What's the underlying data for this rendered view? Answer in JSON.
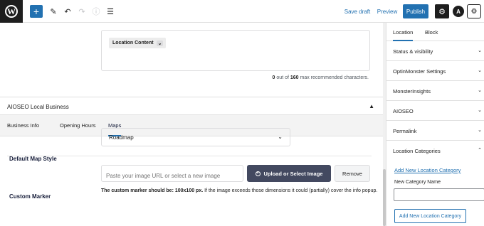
{
  "toolbar": {
    "logo": "W",
    "add_icon": "+",
    "edit_icon": "✎",
    "undo_icon": "↶",
    "redo_icon": "↷",
    "info_icon": "ⓘ",
    "list_icon": "☰",
    "save_draft": "Save draft",
    "preview": "Preview",
    "publish": "Publish",
    "settings_icon": "⚙",
    "aioseo_icon": "A",
    "monsterinsights_icon": "⚙"
  },
  "editor": {
    "content_pill": "Location Content",
    "pill_chevron": "⌄",
    "char_count": "0",
    "char_max": "160",
    "char_suffix": "out of",
    "char_tail": "max recommended characters."
  },
  "metabox": {
    "title": "AIOSEO Local Business",
    "collapse_icon": "▲",
    "tabs": [
      "Business Info",
      "Opening Hours",
      "Maps"
    ],
    "active_tab": "Maps",
    "map_style_label": "Default Map Style",
    "map_style_value": "Roadmap",
    "custom_marker_label": "Custom Marker",
    "image_placeholder": "Paste your image URL or select a new image",
    "upload_button": "Upload or Select Image",
    "remove_button": "Remove",
    "note_bold": "The custom marker should be: 100x100 px.",
    "note_text": " If the image exceeds those dimensions it could (partially) cover the info popup."
  },
  "sidebar": {
    "tabs": [
      "Location",
      "Block"
    ],
    "active_tab": "Location",
    "panels": [
      {
        "label": "Status & visibility"
      },
      {
        "label": "OptinMonster Settings"
      },
      {
        "label": "MonsterInsights"
      },
      {
        "label": "AIOSEO"
      },
      {
        "label": "Permalink"
      },
      {
        "label": "Location Categories"
      }
    ],
    "add_category_link": "Add New Location Category",
    "new_category_label": "New Category Name",
    "add_category_button": "Add New Location Category"
  },
  "colors": {
    "accent": "#2271b1",
    "dark": "#1e1e1e",
    "upload_button_bg": "#434960"
  }
}
